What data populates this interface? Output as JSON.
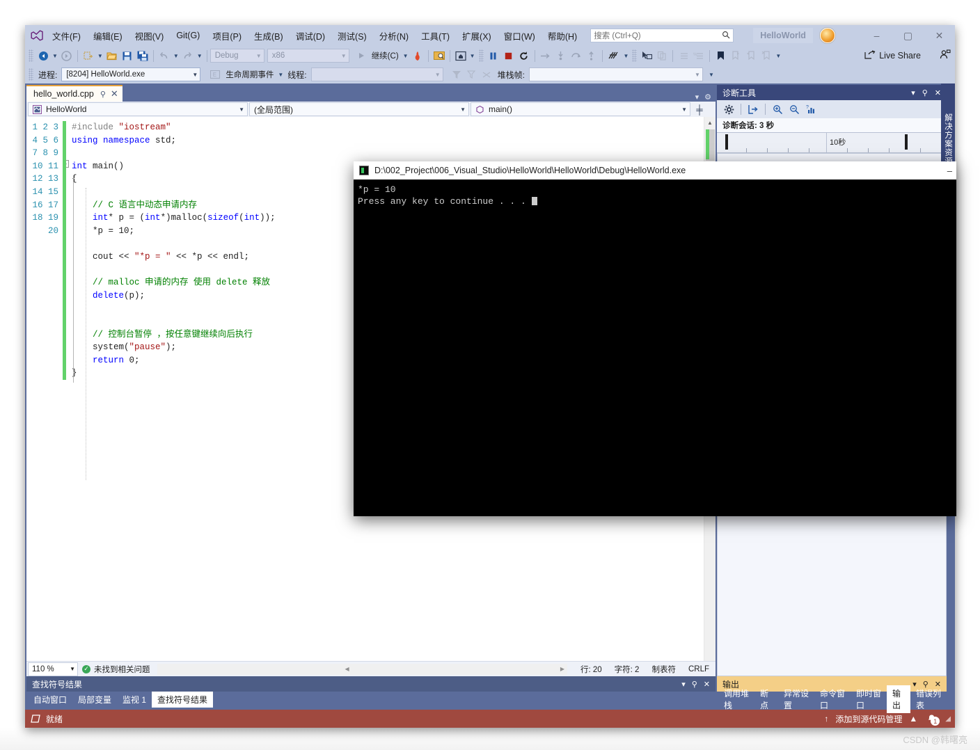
{
  "window": {
    "project_badge": "HelloWorld",
    "minimize": "–",
    "maximize": "▢",
    "close": "✕"
  },
  "menu": {
    "items": [
      {
        "label": "文件(F)"
      },
      {
        "label": "编辑(E)"
      },
      {
        "label": "视图(V)"
      },
      {
        "label": "Git(G)"
      },
      {
        "label": "项目(P)"
      },
      {
        "label": "生成(B)"
      },
      {
        "label": "调试(D)"
      },
      {
        "label": "测试(S)"
      },
      {
        "label": "分析(N)"
      },
      {
        "label": "工具(T)"
      },
      {
        "label": "扩展(X)"
      },
      {
        "label": "窗口(W)"
      },
      {
        "label": "帮助(H)"
      }
    ]
  },
  "search": {
    "placeholder": "搜索 (Ctrl+Q)",
    "icon": "search-icon"
  },
  "toolbar": {
    "back": "◀",
    "forward": "▶",
    "new_item": "▣",
    "open": "📂",
    "save": "💾",
    "save_all": "🖫",
    "undo": "↰",
    "redo": "↱",
    "config": "Debug",
    "platform": "x86",
    "continue": "继续(C)",
    "hot_reload": "🔥",
    "pause": "❚❚",
    "stop": "■",
    "restart": "↺",
    "step_into": "↓",
    "step_over": "↷",
    "step_out": "↑",
    "show_next": "→",
    "live_share": "Live Share"
  },
  "process_row": {
    "process_label": "进程:",
    "process_value": "[8204] HelloWorld.exe",
    "lifecycle_events": "生命周期事件",
    "thread_label": "线程:",
    "thread_value": "",
    "stack_label": "堆栈帧:",
    "stack_value": ""
  },
  "editor": {
    "tab_name": "hello_world.cpp",
    "pin": "⚲",
    "close": "✕",
    "scope_project": "HelloWorld",
    "scope_global": "(全局范围)",
    "scope_function": "main()",
    "lines": [
      {
        "n": 1,
        "html": "<span class='k-pp'>#include </span><span class='k-str'>\"iostream\"</span>"
      },
      {
        "n": 2,
        "html": "<span class='k-kw'>using</span> <span class='k-kw'>namespace</span> std;"
      },
      {
        "n": 3,
        "html": ""
      },
      {
        "n": 4,
        "html": "<span class='k-kw'>int</span> main()"
      },
      {
        "n": 5,
        "html": "{"
      },
      {
        "n": 6,
        "html": ""
      },
      {
        "n": 7,
        "html": "    <span class='k-com'>// C 语言中动态申请内存</span>"
      },
      {
        "n": 8,
        "html": "    <span class='k-kw'>int</span>* p = (<span class='k-kw'>int</span>*)malloc(<span class='k-kw'>sizeof</span>(<span class='k-kw'>int</span>));"
      },
      {
        "n": 9,
        "html": "    *p = 10;"
      },
      {
        "n": 10,
        "html": ""
      },
      {
        "n": 11,
        "html": "    cout &lt;&lt; <span class='k-str'>\"*p = \"</span> &lt;&lt; *p &lt;&lt; endl;"
      },
      {
        "n": 12,
        "html": ""
      },
      {
        "n": 13,
        "html": "    <span class='k-com'>// malloc 申请的内存 使用 delete 释放</span>"
      },
      {
        "n": 14,
        "html": "    <span class='k-kw'>delete</span>(p);"
      },
      {
        "n": 15,
        "html": ""
      },
      {
        "n": 16,
        "html": ""
      },
      {
        "n": 17,
        "html": "    <span class='k-com'>// 控制台暂停 ，按任意键继续向后执行</span>"
      },
      {
        "n": 18,
        "html": "    system(<span class='k-str'>\"pause\"</span>);"
      },
      {
        "n": 19,
        "html": "    <span class='k-kw'>return</span> 0;"
      },
      {
        "n": 20,
        "html": "}"
      }
    ]
  },
  "editor_status": {
    "zoom": "110 %",
    "issue_status": "未找到相关问题",
    "line": "行: 20",
    "column": "字符: 2",
    "tabs": "制表符",
    "eol": "CRLF"
  },
  "bottom_left_panel": {
    "title": "查找符号结果",
    "tabs": [
      {
        "label": "自动窗口",
        "active": false
      },
      {
        "label": "局部变量",
        "active": false
      },
      {
        "label": "监视 1",
        "active": false
      },
      {
        "label": "查找符号结果",
        "active": true
      }
    ]
  },
  "bottom_right_panel": {
    "title": "输出",
    "dropdown": "▾",
    "pin": "⚲",
    "close": "✕",
    "tabs": [
      {
        "label": "调用堆栈",
        "active": false
      },
      {
        "label": "断点",
        "active": false
      },
      {
        "label": "异常设置",
        "active": false
      },
      {
        "label": "命令窗口",
        "active": false
      },
      {
        "label": "即时窗口",
        "active": false
      },
      {
        "label": "输出",
        "active": true
      },
      {
        "label": "错误列表",
        "active": false
      }
    ]
  },
  "diagnostics": {
    "title": "诊断工具",
    "dropdown": "▾",
    "pin": "⚲",
    "close": "✕",
    "toolbar": [
      {
        "name": "gear-icon",
        "glyph": "⚙"
      },
      {
        "name": "export-icon",
        "glyph": "⇥"
      },
      {
        "name": "zoom-in-icon",
        "glyph": "🔍"
      },
      {
        "name": "zoom-out-icon",
        "glyph": "🔍"
      },
      {
        "name": "chart-icon",
        "glyph": "📊"
      }
    ],
    "session_label": "诊断会话: 3 秒",
    "ruler_label": "10秒"
  },
  "solution_explorer_tab": "解决方案资源管理器",
  "statusbar": {
    "state": "就绪",
    "source_control": "添加到源代码管理",
    "notification_count": "1",
    "up_arrow": "↑",
    "caret": "▲"
  },
  "console": {
    "title": "D:\\002_Project\\006_Visual_Studio\\HelloWorld\\HelloWorld\\Debug\\HelloWorld.exe",
    "minimize": "–",
    "line1": "*p = 10",
    "line2": "Press any key to continue . . ."
  },
  "watermark": "CSDN @韩曙亮",
  "colors": {
    "frame": "#c5cfe4",
    "dock": "#5b6c9b",
    "panel_header": "#4d5d86",
    "diag_header": "#39477a",
    "output_header": "#f4cf87",
    "status_debug": "#a0493f",
    "tab_accent": "#e6a03a",
    "change_bar": "#62d26a"
  }
}
